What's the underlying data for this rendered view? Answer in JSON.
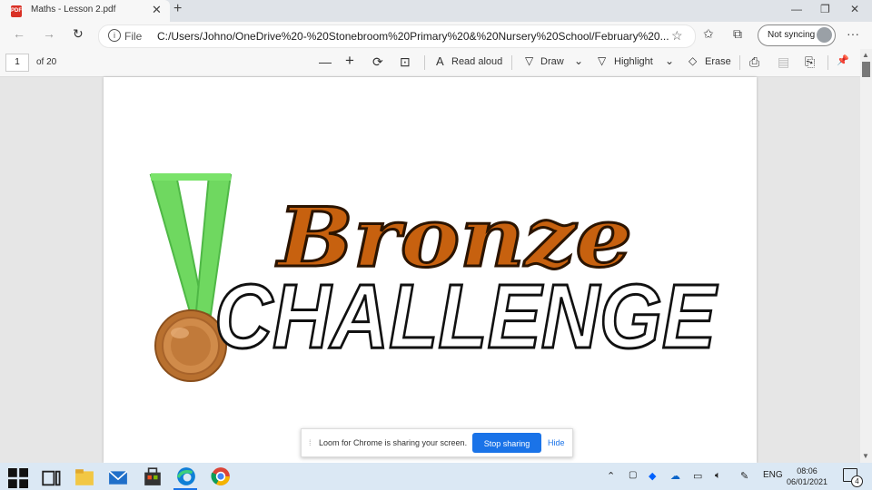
{
  "tab": {
    "title": "Maths - Lesson 2.pdf",
    "close": "✕",
    "pdf_badge": "PDF"
  },
  "new_tab": "+",
  "window_controls": {
    "minimize": "—",
    "restore": "❐",
    "close": "✕"
  },
  "nav": {
    "back": "←",
    "forward": "→",
    "refresh": "↻"
  },
  "address": {
    "scheme_label": "File",
    "url": "C:/Users/Johno/OneDrive%20-%20Stonebroom%20Primary%20&%20Nursery%20School/February%20...",
    "star": "☆"
  },
  "toolbar_icons": {
    "favorites": "✩",
    "collections": "⧉",
    "more": "···"
  },
  "profile": {
    "label": "Not syncing"
  },
  "pdf_toolbar": {
    "page_current": "1",
    "page_total": "of 20",
    "zoom_out": "—",
    "zoom_in": "+",
    "rotate": "⟳",
    "fit": "⊡",
    "read_aloud_icon": "A",
    "read_aloud": "Read aloud",
    "draw_icon": "▽",
    "draw": "Draw",
    "highlight_icon": "▽",
    "highlight": "Highlight",
    "chevron": "⌄",
    "erase_icon": "◇",
    "erase": "Erase",
    "print": "⎙",
    "save": "▤",
    "save_as": "⎘",
    "pin": "📌"
  },
  "slide": {
    "word1": "Bronze",
    "word2": "CHALLENGE",
    "colors": {
      "bronze": "#c7610f",
      "ribbon": "#6fd860",
      "medal": "#c17a3a"
    }
  },
  "loom": {
    "handle": "⁞",
    "message": "Loom for Chrome is sharing your screen.",
    "stop": "Stop sharing",
    "hide": "Hide"
  },
  "scrollbar": {
    "up": "▲",
    "down": "▼"
  },
  "taskbar": {
    "tray_chevron": "⌃",
    "language": "ENG",
    "time": "08:06",
    "date": "06/01/2021",
    "notifications": "4"
  }
}
